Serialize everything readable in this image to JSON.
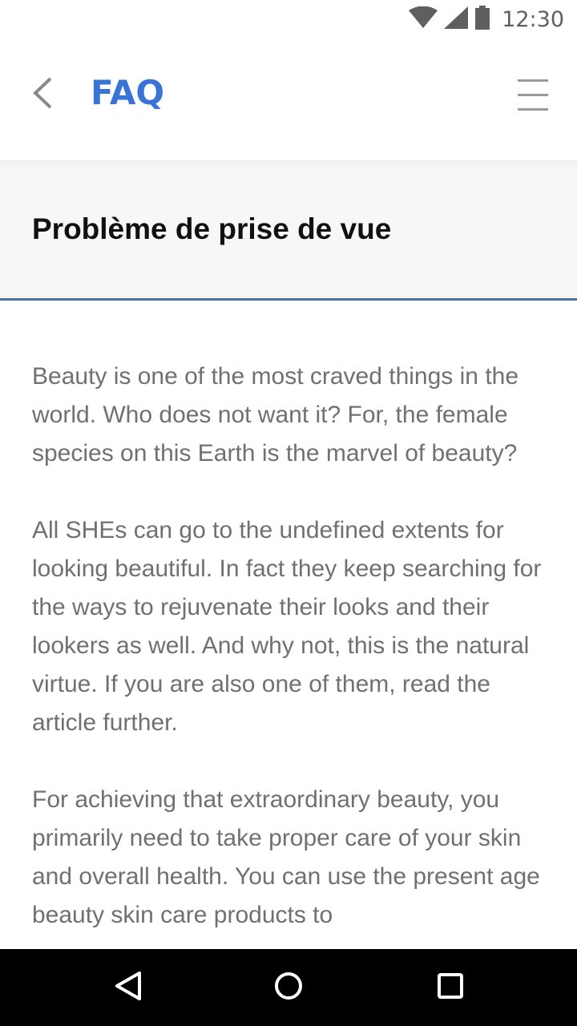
{
  "status_bar": {
    "time": "12:30",
    "icons": [
      "wifi-icon",
      "signal-icon",
      "battery-icon"
    ]
  },
  "app_bar": {
    "title": "FAQ",
    "back_icon": "chevron-left-icon",
    "menu_icon": "hamburger-menu-icon"
  },
  "section": {
    "title": "Problème de prise de vue"
  },
  "article": {
    "paragraphs": [
      "Beauty is one of the most craved things in the world. Who does not want it? For, the female species on this Earth is the marvel of beauty?",
      "All SHEs can go to the undefined extents for looking beautiful. In fact they keep searching for the ways to rejuvenate their looks and their lookers as well. And why not, this is the natural virtue. If you are also one of them, read the article further.",
      "For achieving that extraordinary beauty, you primarily need to take proper care of your skin and overall health. You can use the present age beauty skin care products to"
    ]
  },
  "nav_bar": {
    "icons": [
      "back-triangle-icon",
      "home-circle-icon",
      "recents-square-icon"
    ]
  },
  "colors": {
    "accent": "#3a73d6",
    "divider": "#4a72a8",
    "body_text": "#707070",
    "header_bg": "#f7f7f7"
  }
}
